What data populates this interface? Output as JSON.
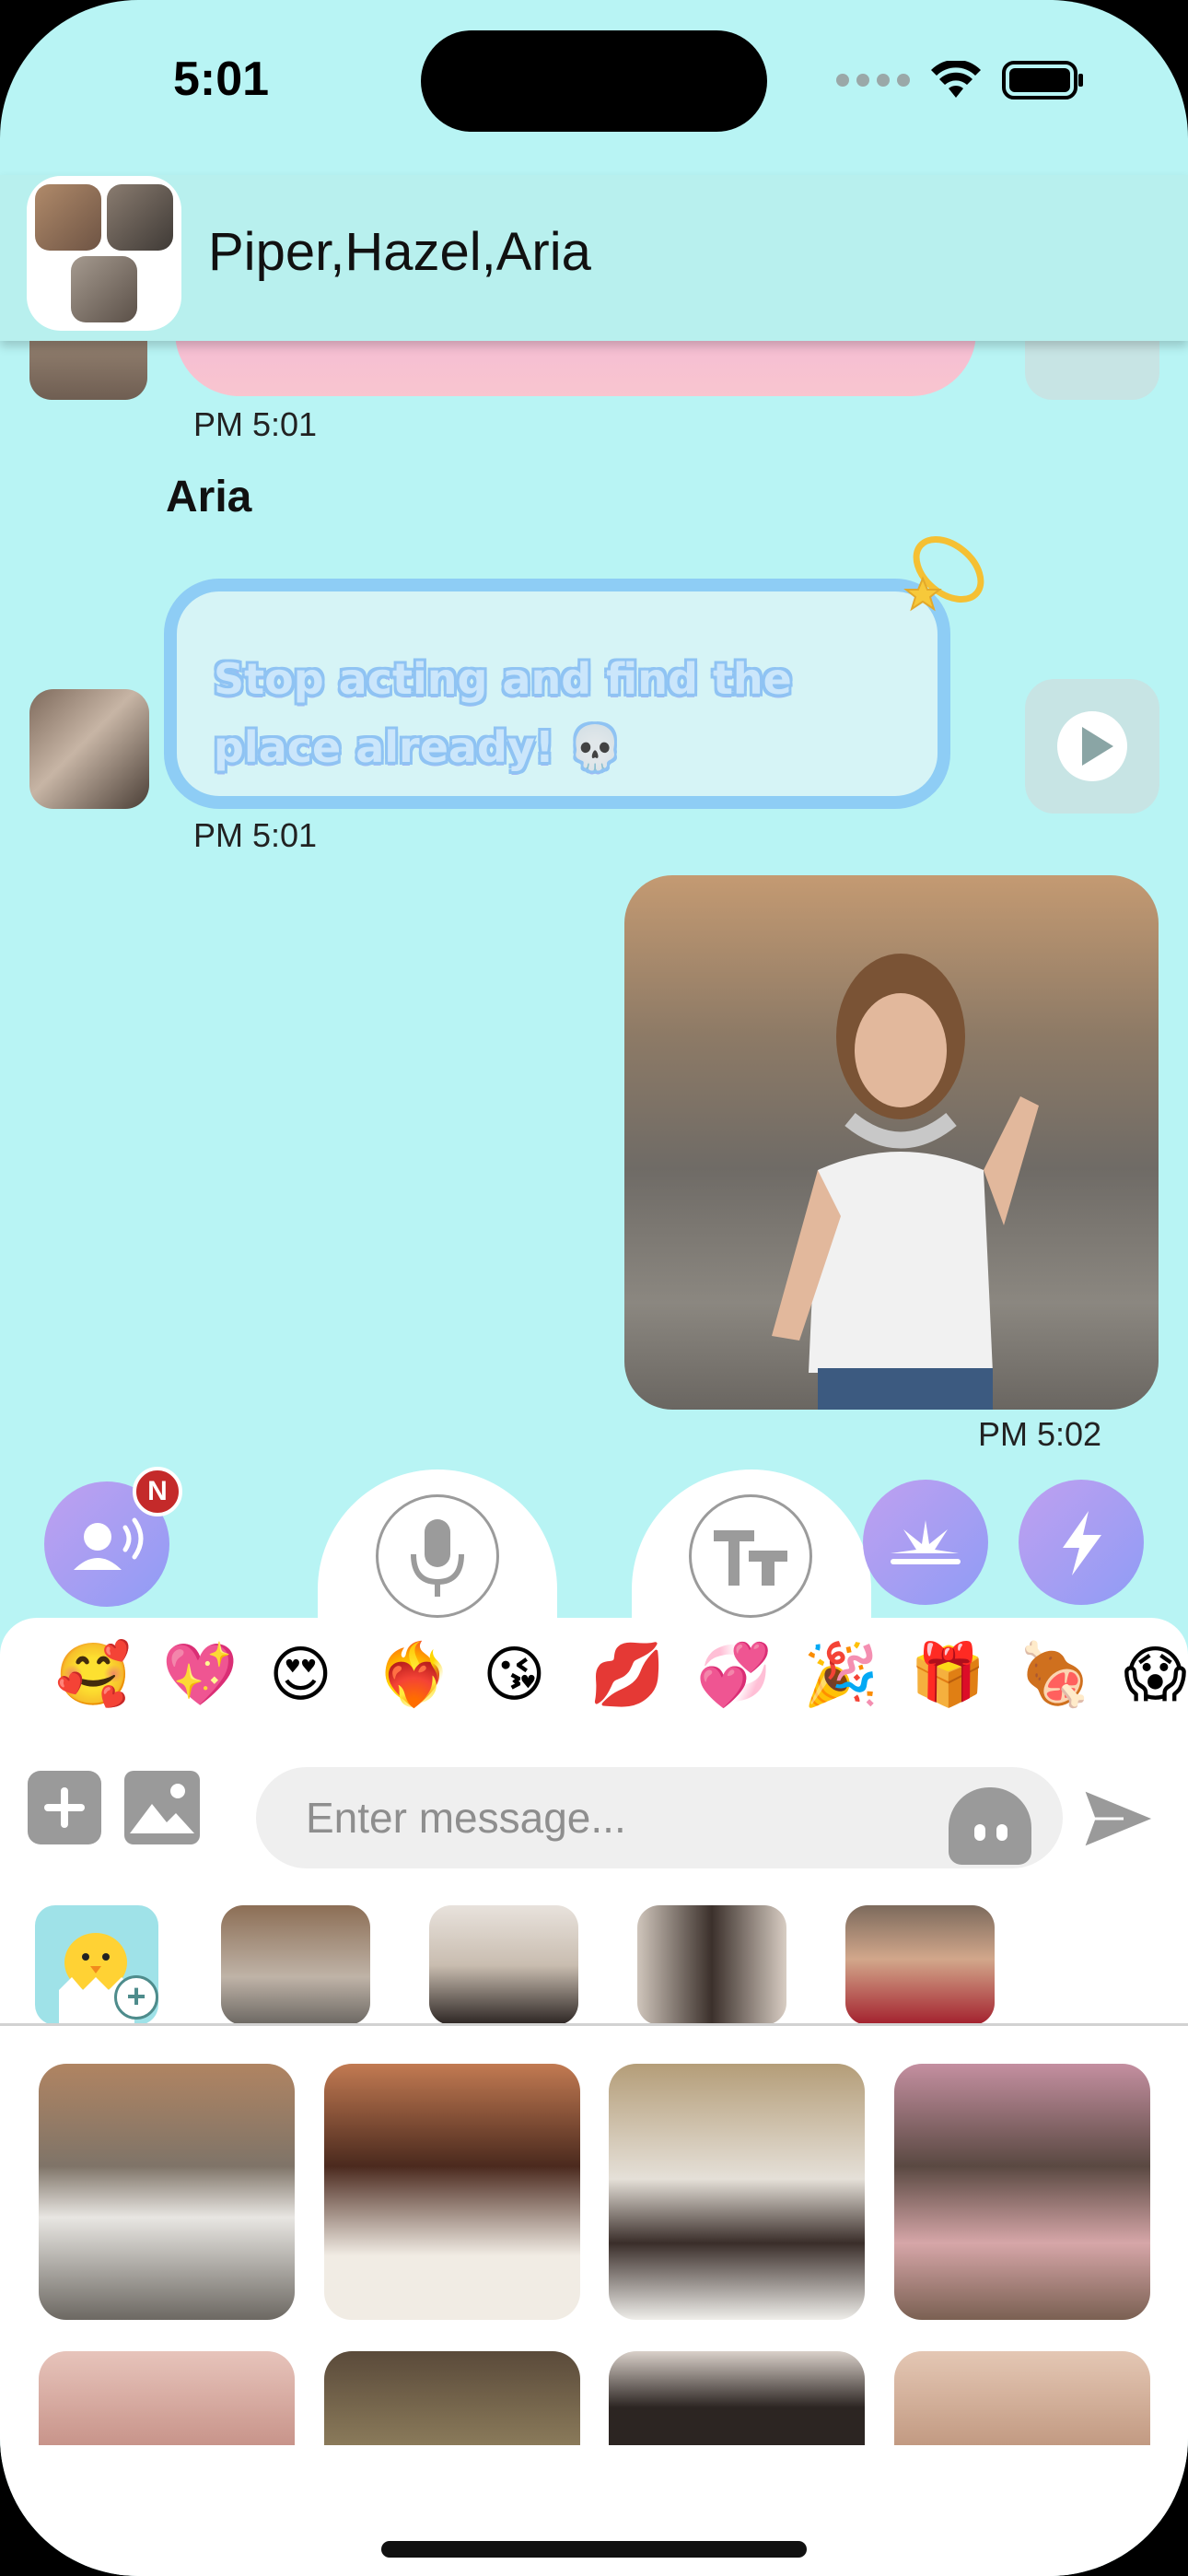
{
  "status_bar": {
    "time": "5:01",
    "icons": [
      "cellular-dots-icon",
      "wifi-icon",
      "battery-icon"
    ]
  },
  "header": {
    "title": "Piper,Hazel,Aria",
    "avatar": "group-avatar"
  },
  "messages": [
    {
      "type": "voice-text",
      "sender": "",
      "timestamp": "PM 5:01",
      "partial": true,
      "bubble_color": "#f6c0d4"
    },
    {
      "type": "voice-text",
      "sender": "Aria",
      "text": "Stop acting and find the place already! 💀",
      "timestamp": "PM 5:01",
      "bubble_color": "#8ecdf5"
    },
    {
      "type": "video",
      "outgoing": true,
      "timestamp": "PM 5:02"
    }
  ],
  "actions": {
    "voice_badge": "N",
    "tabs": [
      "mic-icon",
      "text-style-icon"
    ]
  },
  "emojis": [
    "🥰",
    "💖",
    "😍",
    "❤️‍🔥",
    "😘",
    "💋",
    "💞",
    "🎉",
    "🎁",
    "🍖",
    "😱"
  ],
  "composer": {
    "placeholder": "Enter message...",
    "value": ""
  },
  "thumbnail_labels": {
    "chick_plus": "+"
  },
  "colors": {
    "background": "#b8f4f4",
    "header": "#b8f0ee",
    "accent_gradient_start": "#bfa0f0",
    "accent_gradient_end": "#8f9cf5",
    "badge": "#c42a2a",
    "bubble_border": "#8ecdf5"
  }
}
